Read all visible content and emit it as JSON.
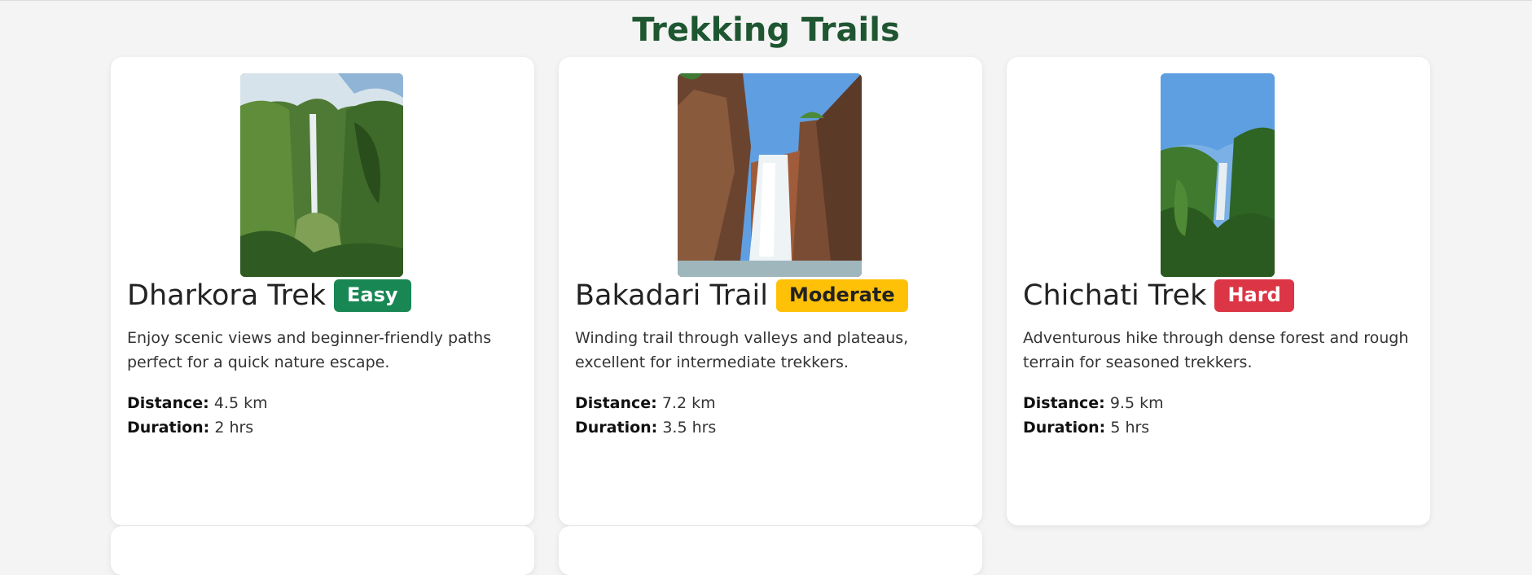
{
  "page": {
    "title": "Trekking Trails"
  },
  "trails": [
    {
      "name": "Dharkora Trek",
      "difficulty": "Easy",
      "difficulty_color": "#198754",
      "description": "Enjoy scenic views and beginner-friendly paths perfect for a quick nature escape.",
      "distance_label": "Distance:",
      "distance": "4.5 km",
      "duration_label": "Duration:",
      "duration": "2 hrs"
    },
    {
      "name": "Bakadari Trail",
      "difficulty": "Moderate",
      "difficulty_color": "#ffc107",
      "description": "Winding trail through valleys and plateaus, excellent for intermediate trekkers.",
      "distance_label": "Distance:",
      "distance": "7.2 km",
      "duration_label": "Duration:",
      "duration": "3.5 hrs"
    },
    {
      "name": "Chichati Trek",
      "difficulty": "Hard",
      "difficulty_color": "#dc3545",
      "description": "Adventurous hike through dense forest and rough terrain for seasoned trekkers.",
      "distance_label": "Distance:",
      "distance": "9.5 km",
      "duration_label": "Duration:",
      "duration": "5 hrs"
    }
  ]
}
